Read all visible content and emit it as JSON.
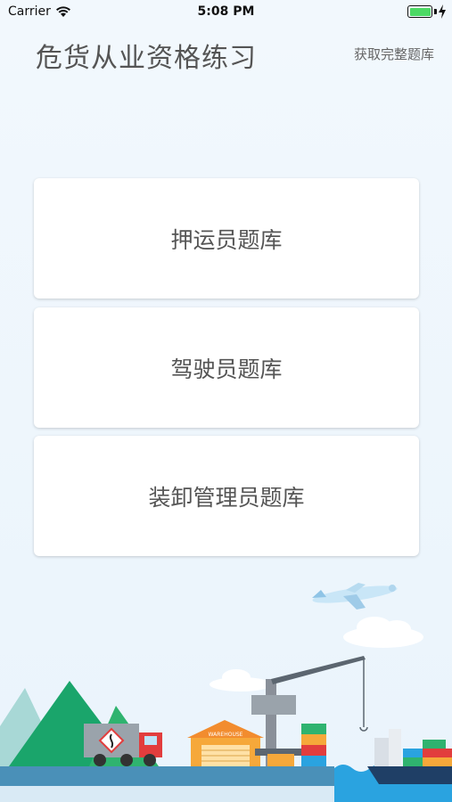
{
  "status_bar": {
    "carrier": "Carrier",
    "time": "5:08 PM"
  },
  "header": {
    "title": "危货从业资格练习",
    "action_label": "获取完整题库"
  },
  "question_banks": [
    {
      "label": "押运员题库"
    },
    {
      "label": "驾驶员题库"
    },
    {
      "label": "装卸管理员题库"
    }
  ],
  "illustration": {
    "warehouse_sign": "WAREHOUSE"
  },
  "colors": {
    "background": "#eef6fc",
    "card": "#ffffff",
    "mountain_dark": "#1aa56b",
    "mountain_light": "#a8d8d6",
    "water": "#2aa3e0",
    "ground": "#4a90b8"
  }
}
